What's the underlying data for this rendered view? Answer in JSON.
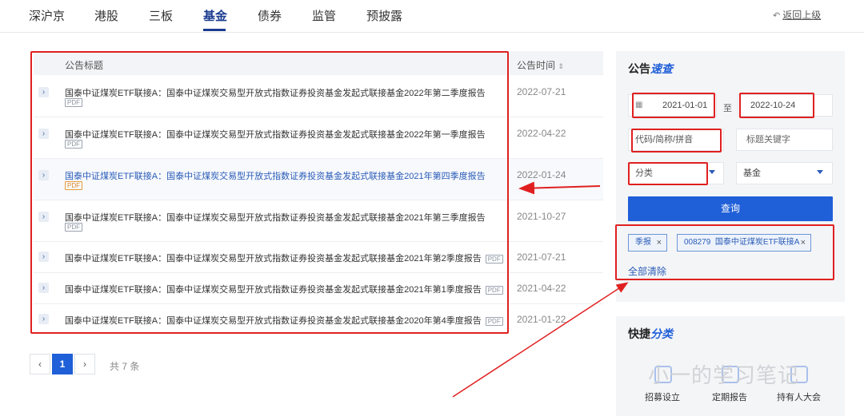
{
  "nav": {
    "tabs": [
      "深沪京",
      "港股",
      "三板",
      "基金",
      "债券",
      "监管",
      "预披露"
    ],
    "active": "基金",
    "back_label": "返回上级"
  },
  "table": {
    "col_title": "公告标题",
    "col_date": "公告时间",
    "rows": [
      {
        "title": "国泰中证煤炭ETF联接A：国泰中证煤炭交易型开放式指数证券投资基金发起式联接基金2022年第二季度报告",
        "pdf": "PDF",
        "date": "2022-07-21"
      },
      {
        "title": "国泰中证煤炭ETF联接A：国泰中证煤炭交易型开放式指数证券投资基金发起式联接基金2022年第一季度报告",
        "pdf": "PDF",
        "date": "2022-04-22"
      },
      {
        "title": "国泰中证煤炭ETF联接A：国泰中证煤炭交易型开放式指数证券投资基金发起式联接基金2021年第四季度报告",
        "pdf": "PDF",
        "date": "2022-01-24"
      },
      {
        "title": "国泰中证煤炭ETF联接A：国泰中证煤炭交易型开放式指数证券投资基金发起式联接基金2021年第三季度报告",
        "pdf": "PDF",
        "date": "2021-10-27"
      },
      {
        "title": "国泰中证煤炭ETF联接A：国泰中证煤炭交易型开放式指数证券投资基金发起式联接基金2021年第2季度报告",
        "pdf": "PDF",
        "date": "2021-07-21"
      },
      {
        "title": "国泰中证煤炭ETF联接A：国泰中证煤炭交易型开放式指数证券投资基金发起式联接基金2021年第1季度报告",
        "pdf": "PDF",
        "date": "2021-04-22"
      },
      {
        "title": "国泰中证煤炭ETF联接A：国泰中证煤炭交易型开放式指数证券投资基金发起式联接基金2020年第4季度报告",
        "pdf": "PDF",
        "date": "2021-01-22"
      }
    ]
  },
  "pagination": {
    "prev": "‹",
    "current": "1",
    "next": "›",
    "total": "共 7 条"
  },
  "search": {
    "title_a": "公告",
    "title_b": "速查",
    "date_from": "2021-01-01",
    "date_sep": "至",
    "date_to": "2022-10-24",
    "code_placeholder": "代码/简称/拼音",
    "keyword_placeholder": "标题关键字",
    "category_placeholder": "分类",
    "type_value": "基金",
    "query_button": "查询",
    "tags": [
      "季报",
      "008279  国泰中证煤炭ETF联接A"
    ],
    "clear_all": "全部清除"
  },
  "quick": {
    "title_a": "快捷",
    "title_b": "分类",
    "items": [
      "招募设立",
      "定期报告",
      "持有人大会"
    ],
    "watermark": "小一的学习笔记"
  },
  "colors": {
    "accent": "#1f5fd8",
    "annotation": "#e02020",
    "pdf_highlight": "#e08a2a"
  }
}
